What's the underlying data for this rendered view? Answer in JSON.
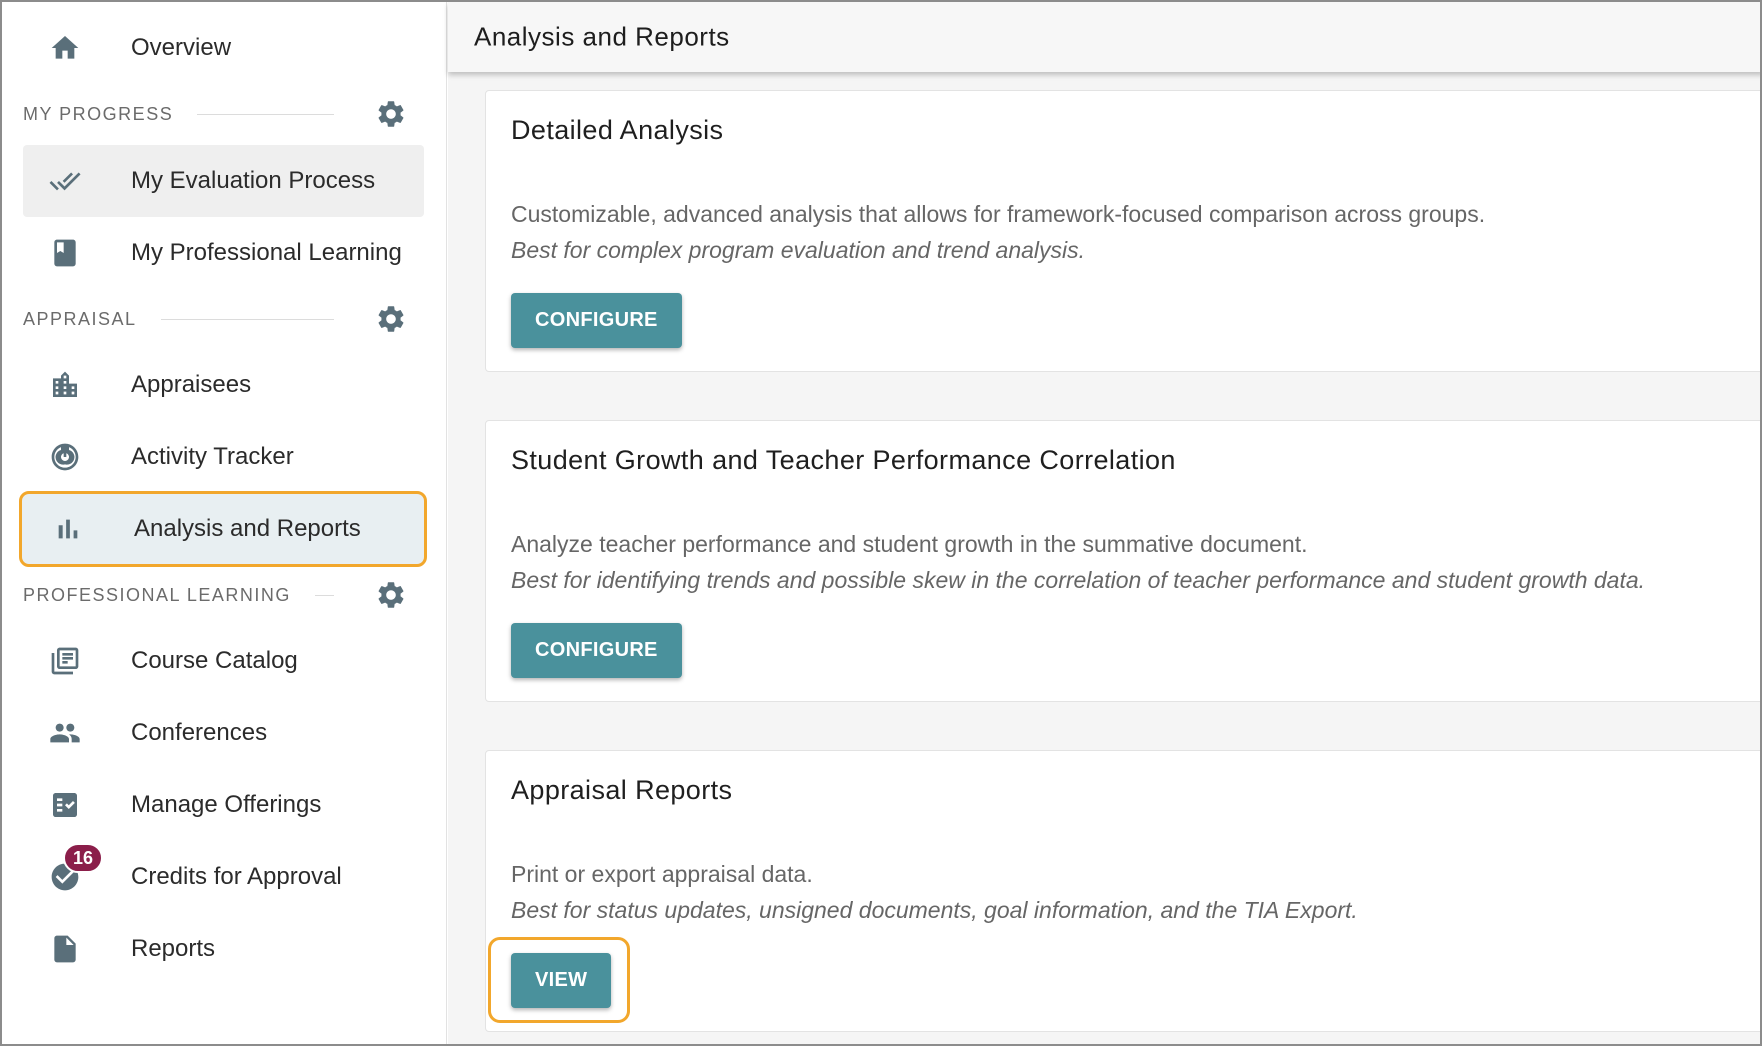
{
  "sidebar": {
    "overview": {
      "label": "Overview",
      "icon": "home-icon"
    },
    "sections": {
      "my_progress": {
        "title": "MY PROGRESS"
      },
      "appraisal": {
        "title": "APPRAISAL"
      },
      "professional_learning": {
        "title": "PROFESSIONAL LEARNING"
      }
    },
    "items": {
      "my_evaluation_process": {
        "label": "My Evaluation Process",
        "icon": "double-check-icon"
      },
      "my_professional_learning": {
        "label": "My Professional Learning",
        "icon": "book-icon"
      },
      "appraisees": {
        "label": "Appraisees",
        "icon": "building-icon"
      },
      "activity_tracker": {
        "label": "Activity Tracker",
        "icon": "target-icon"
      },
      "analysis_and_reports": {
        "label": "Analysis and Reports",
        "icon": "bar-chart-icon"
      },
      "course_catalog": {
        "label": "Course Catalog",
        "icon": "library-books-icon"
      },
      "conferences": {
        "label": "Conferences",
        "icon": "people-icon"
      },
      "manage_offerings": {
        "label": "Manage Offerings",
        "icon": "checklist-icon"
      },
      "credits_for_approval": {
        "label": "Credits for Approval",
        "icon": "check-circle-icon",
        "badge": "16"
      },
      "reports": {
        "label": "Reports",
        "icon": "document-icon"
      }
    }
  },
  "header": {
    "title": "Analysis and Reports"
  },
  "cards": [
    {
      "title": "Detailed Analysis",
      "description": "Customizable, advanced analysis that allows for framework-focused comparison across groups.",
      "best_for": "Best for complex program evaluation and trend analysis.",
      "button_label": "CONFIGURE"
    },
    {
      "title": "Student Growth and Teacher Performance Correlation",
      "description": "Analyze teacher performance and student growth in the summative document.",
      "best_for": "Best for identifying trends and possible skew in the correlation of teacher performance and student growth data.",
      "button_label": "CONFIGURE"
    },
    {
      "title": "Appraisal Reports",
      "description": "Print or export appraisal data.",
      "best_for": "Best for status updates, unsigned documents, goal information, and the TIA Export.",
      "button_label": "VIEW"
    }
  ],
  "colors": {
    "accent_button": "#4a919c",
    "highlight_outline": "#f2a72c",
    "badge": "#8b1e4a",
    "icon": "#5a6f7a"
  }
}
